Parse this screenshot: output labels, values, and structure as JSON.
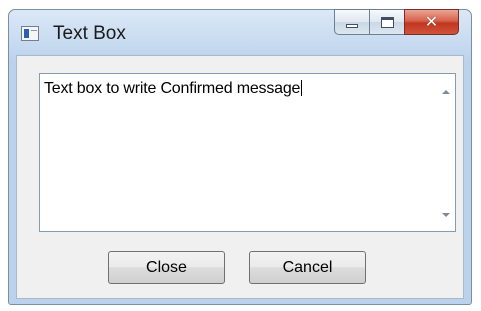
{
  "window": {
    "title": "Text Box",
    "controls": {
      "minimize": "minimize",
      "maximize": "maximize",
      "close": "close"
    }
  },
  "textbox": {
    "value": "Text box to write Confirmed message"
  },
  "buttons": {
    "close_label": "Close",
    "cancel_label": "Cancel"
  },
  "icons": {
    "app": "window-app-icon",
    "scroll_up": "chevron-up-icon",
    "scroll_down": "chevron-down-icon"
  },
  "colors": {
    "title_frame": "#c9dcf1",
    "close_button": "#c1371f",
    "textbox_border": "#7f9db9",
    "client_bg": "#f0f0f0"
  }
}
